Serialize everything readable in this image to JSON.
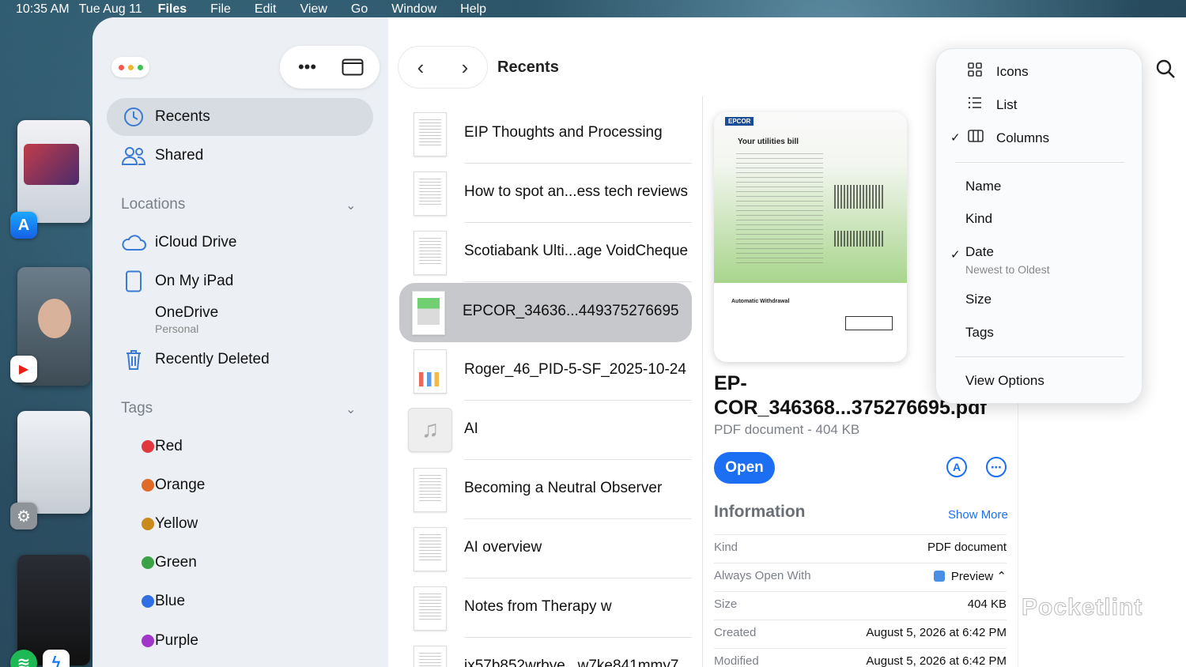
{
  "menubar": {
    "time": "10:35 AM",
    "date": "Tue Aug 11",
    "app": "Files",
    "menus": [
      "File",
      "Edit",
      "View",
      "Go",
      "Window",
      "Help"
    ]
  },
  "sidebar": {
    "recents": "Recents",
    "shared": "Shared",
    "locations_header": "Locations",
    "locations": [
      {
        "label": "iCloud Drive",
        "icon": "cloud-icon"
      },
      {
        "label": "On My iPad",
        "icon": "ipad-icon"
      },
      {
        "label": "OneDrive",
        "sub": "Personal"
      },
      {
        "label": "Recently Deleted",
        "icon": "trash-icon"
      }
    ],
    "tags_header": "Tags",
    "tags": [
      {
        "label": "Red",
        "color": "#e0383e"
      },
      {
        "label": "Orange",
        "color": "#e06a27"
      },
      {
        "label": "Yellow",
        "color": "#c98a1c"
      },
      {
        "label": "Green",
        "color": "#3aa346"
      },
      {
        "label": "Blue",
        "color": "#2f6fe3"
      },
      {
        "label": "Purple",
        "color": "#a236c8"
      }
    ]
  },
  "nav": {
    "title": "Recents"
  },
  "files": [
    {
      "name": "EIP Thoughts and Processing",
      "kind": "doc"
    },
    {
      "name": "How to spot an...ess tech reviews",
      "kind": "doc"
    },
    {
      "name": "Scotiabank Ulti...age VoidCheque",
      "kind": "doc"
    },
    {
      "name": "EPCOR_34636...449375276695",
      "kind": "green",
      "selected": true
    },
    {
      "name": "Roger_46_PID-5-SF_2025-10-24",
      "kind": "chart"
    },
    {
      "name": "AI",
      "kind": "audio"
    },
    {
      "name": "Becoming a Neutral Observer",
      "kind": "doc"
    },
    {
      "name": "AI overview",
      "kind": "doc"
    },
    {
      "name": "Notes from Therapy w",
      "kind": "doc"
    },
    {
      "name": "ix57b852wrbye...w7ke841mmy7",
      "kind": "doc"
    }
  ],
  "preview": {
    "doc_logo": "EPCOR",
    "doc_heading": "Your utilities bill",
    "doc_bottom_title": "Automatic Withdrawal",
    "name": "EP-\nCOR_346368...375276695.pdf",
    "meta": "PDF document - 404 KB",
    "open_label": "Open",
    "info_title": "Information",
    "show_more": "Show More",
    "info": [
      {
        "key": "Kind",
        "value": "PDF document"
      },
      {
        "key": "Always Open With",
        "value": "Preview ⌃"
      },
      {
        "key": "Size",
        "value": "404 KB"
      },
      {
        "key": "Created",
        "value": "August 5, 2026 at 6:42 PM"
      },
      {
        "key": "Modified",
        "value": "August 5, 2026 at 6:42 PM"
      }
    ]
  },
  "view_menu": {
    "layouts": [
      {
        "label": "Icons",
        "checked": false,
        "icon": "grid-icon"
      },
      {
        "label": "List",
        "checked": false,
        "icon": "list-icon"
      },
      {
        "label": "Columns",
        "checked": true,
        "icon": "columns-icon"
      }
    ],
    "sort": [
      {
        "label": "Name",
        "checked": false
      },
      {
        "label": "Kind",
        "checked": false
      },
      {
        "label": "Date",
        "checked": true,
        "sub": "Newest to Oldest"
      },
      {
        "label": "Size",
        "checked": false
      },
      {
        "label": "Tags",
        "checked": false
      }
    ],
    "view_options": "View Options"
  },
  "watermark": "Pocketlint",
  "accent_color": "#1c6ff2"
}
